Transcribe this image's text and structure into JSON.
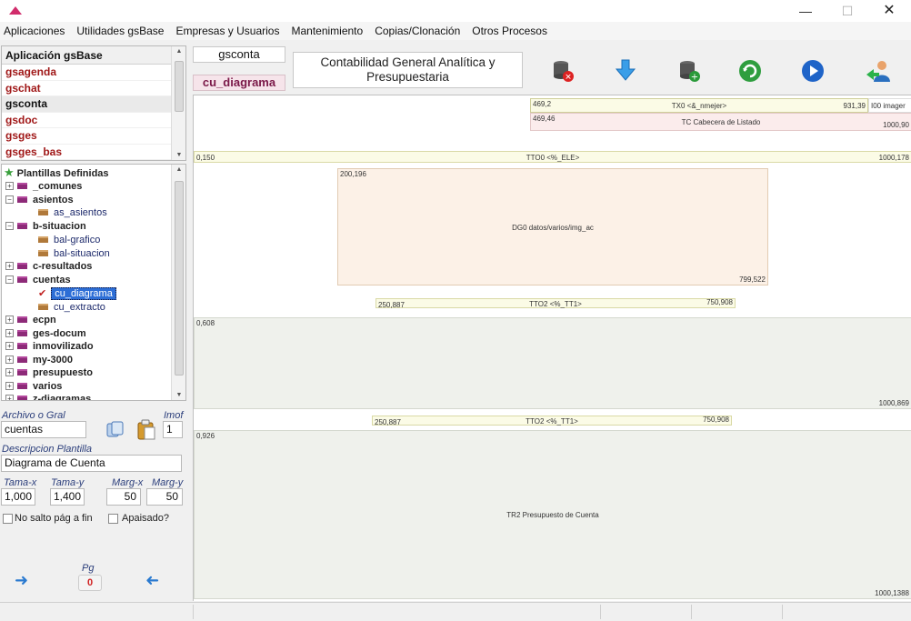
{
  "menu": [
    "Aplicaciones",
    "Utilidades gsBase",
    "Empresas y Usuarios",
    "Mantenimiento",
    "Copias/Clonación",
    "Otros Procesos"
  ],
  "window": {
    "min": "—",
    "max": "☐",
    "close": "✕"
  },
  "applist": {
    "header": "Aplicación gsBase",
    "items": [
      "gsagenda",
      "gschat",
      "gsconta",
      "gsdoc",
      "gsges",
      "gsges_bas"
    ]
  },
  "tree": {
    "root": "Plantillas Definidas",
    "rows": [
      {
        "label": "_comunes",
        "pm": "+"
      },
      {
        "label": "asientos",
        "pm": "−"
      },
      {
        "label": "as_asientos"
      },
      {
        "label": "b-situacion",
        "pm": "−"
      },
      {
        "label": "bal-grafico"
      },
      {
        "label": "bal-situacion"
      },
      {
        "label": "c-resultados",
        "pm": "+"
      },
      {
        "label": "cuentas",
        "pm": "−"
      },
      {
        "label": "cu_diagrama"
      },
      {
        "label": "cu_extracto"
      },
      {
        "label": "ecpn",
        "pm": "+"
      },
      {
        "label": "ges-docum",
        "pm": "+"
      },
      {
        "label": "inmovilizado",
        "pm": "+"
      },
      {
        "label": "my-3000",
        "pm": "+"
      },
      {
        "label": "presupuesto",
        "pm": "+"
      },
      {
        "label": "varios",
        "pm": "+"
      },
      {
        "label": "z-diagramas",
        "pm": "+"
      }
    ]
  },
  "form": {
    "archivo_label": "Archivo o Gral",
    "archivo_value": "cuentas",
    "imof_label": "Imof",
    "imof_value": "1",
    "desc_label": "Descripcion Plantilla",
    "desc_value": "Diagrama de Cuenta",
    "tama_x_label": "Tama-x",
    "tama_x": "1,000",
    "tama_y_label": "Tama-y",
    "tama_y": "1,400",
    "marg_x_label": "Marg-x",
    "marg_x": "50",
    "marg_y_label": "Marg-y",
    "marg_y": "50",
    "no_salto_label": "No salto pág a fin",
    "apaisado_label": "Apaisado?",
    "pg_label": "Pg",
    "pg_value": "0"
  },
  "header": {
    "app_tag": "gsconta",
    "template_tag": "cu_diagrama",
    "title": "Contabilidad General Analítica y Presupuestaria"
  },
  "canvas": {
    "b1": {
      "tl": "469,2",
      "mid": "TX0 <&_nmejer>",
      "tr": "931,39",
      "edge": "I00 imager"
    },
    "b2": {
      "tl": "469,46",
      "mid": "TC Cabecera de Listado",
      "br": "1000,90"
    },
    "b3": {
      "tl": "0,150",
      "mid": "TTO0 <%_ELE>",
      "tr": "1000,178"
    },
    "b4": {
      "tl": "200,196",
      "mid": "DG0 datos/varios/img_ac",
      "br": "799,522"
    },
    "b5": {
      "tl": "250,887",
      "mid": "TTO2 <%_TT1>",
      "tr": "750,908"
    },
    "b6": {
      "tl": "0,608",
      "br": "1000,869"
    },
    "b7": {
      "tl": "250,887",
      "mid": "TTO2 <%_TT1>",
      "tr": "750,908"
    },
    "b8": {
      "tl": "0,926",
      "mid": "TR2 Presupuesto de Cuenta",
      "br": "1000,1388"
    }
  },
  "colors": {
    "accent": "#2d6ed6",
    "app_red": "#a01818",
    "yellow_band": "#fbfbe6",
    "pink_band": "#fbecec"
  }
}
